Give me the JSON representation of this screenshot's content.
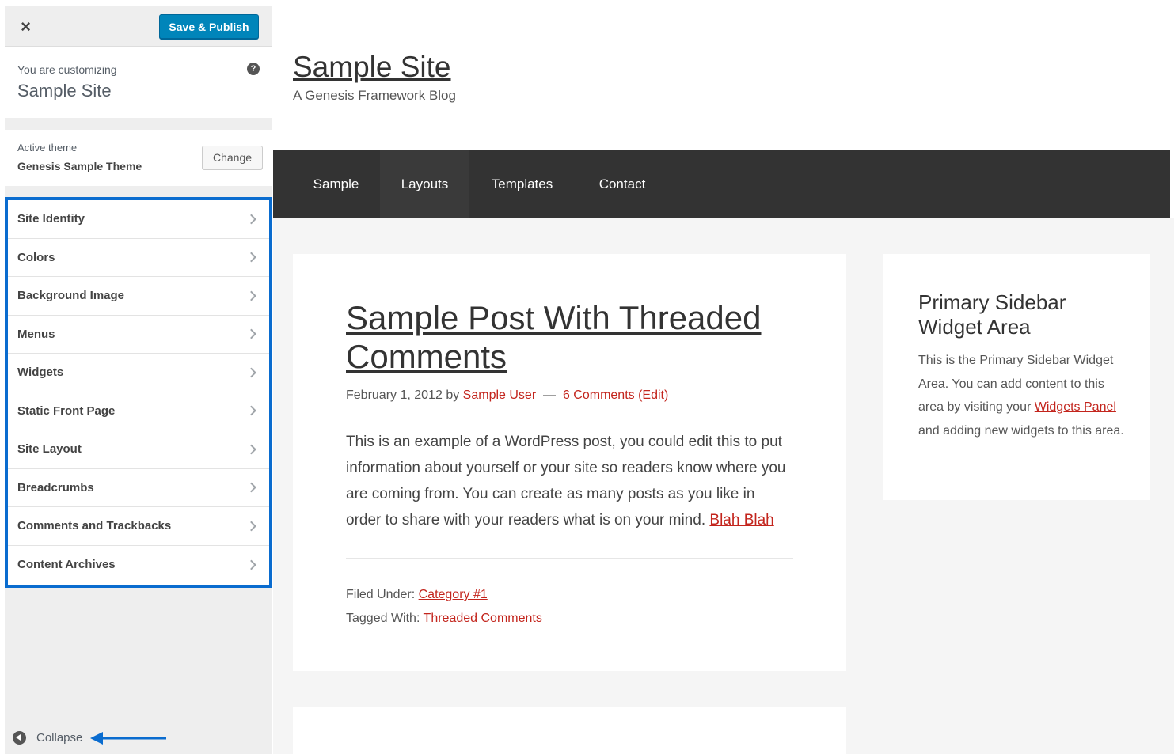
{
  "customizer": {
    "close_symbol": "×",
    "save_label": "Save & Publish",
    "customizing_label": "You are customizing",
    "site_name": "Sample Site",
    "help_symbol": "?",
    "active_theme_label": "Active theme",
    "theme_name": "Genesis Sample Theme",
    "change_label": "Change",
    "sections": [
      {
        "label": "Site Identity"
      },
      {
        "label": "Colors"
      },
      {
        "label": "Background Image"
      },
      {
        "label": "Menus"
      },
      {
        "label": "Widgets"
      },
      {
        "label": "Static Front Page"
      },
      {
        "label": "Site Layout"
      },
      {
        "label": "Breadcrumbs"
      },
      {
        "label": "Comments and Trackbacks"
      },
      {
        "label": "Content Archives"
      }
    ],
    "collapse_label": "Collapse",
    "highlight_color": "#0a6ccf",
    "save_color": "#0085ba"
  },
  "site": {
    "title": "Sample Site",
    "tagline": "A Genesis Framework Blog",
    "nav": [
      "Sample",
      "Layouts",
      "Templates",
      "Contact"
    ],
    "post": {
      "title": "Sample Post With Threaded Comments",
      "date": "February 1, 2012",
      "by": "by",
      "author": "Sample User",
      "dash": "—",
      "comments": "6 Comments",
      "edit": "(Edit)",
      "body": "This is an example of a WordPress post, you could edit this to put information about yourself or your site so readers know where you are coming from. You can create as many posts as you like in order to share with your readers what is on your mind.",
      "body_link": "Blah Blah",
      "filed_label": "Filed Under:",
      "category": "Category #1",
      "tagged_label": "Tagged With:",
      "tag": "Threaded Comments"
    },
    "sidebar": {
      "title": "Primary Sidebar Widget Area",
      "text_before": "This is the Primary Sidebar Widget Area. You can add content to this area by visiting your",
      "link": "Widgets Panel",
      "text_after": "and adding new widgets to this area."
    },
    "link_color": "#c3251d",
    "nav_bg": "#333333"
  }
}
